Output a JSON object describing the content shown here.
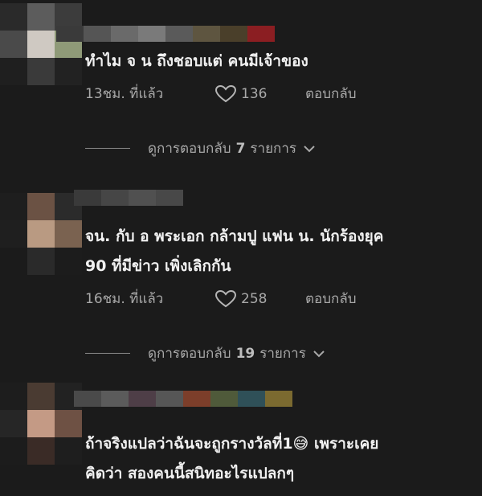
{
  "comments": [
    {
      "text": "ทำไม จ น ถึงชอบแต่ คนมีเจ้าของ",
      "time": "13ชม. ที่แล้ว",
      "likes": "136",
      "reply_label": "ตอบกลับ",
      "view_prefix": "ดูการตอบกลับ",
      "view_count": "7",
      "view_suffix": "รายการ"
    },
    {
      "text": "จน. กับ อ พระเอก กล้ามปู แฟน น. นักร้องยุค\n90 ที่มีข่าว เพิ่งเลิกกัน",
      "time": "16ชม. ที่แล้ว",
      "likes": "258",
      "reply_label": "ตอบกลับ",
      "view_prefix": "ดูการตอบกลับ",
      "view_count": "19",
      "view_suffix": "รายการ"
    },
    {
      "text": "ถ้าจริงแปลว่าฉันจะถูกรางวัลที่1😅 เพราะเคย\nคิดว่า สองคนนี้สนิทอะไรแปลกๆ"
    }
  ],
  "icons": {
    "like": "heart-outline-icon",
    "expand": "chevron-down-icon"
  }
}
